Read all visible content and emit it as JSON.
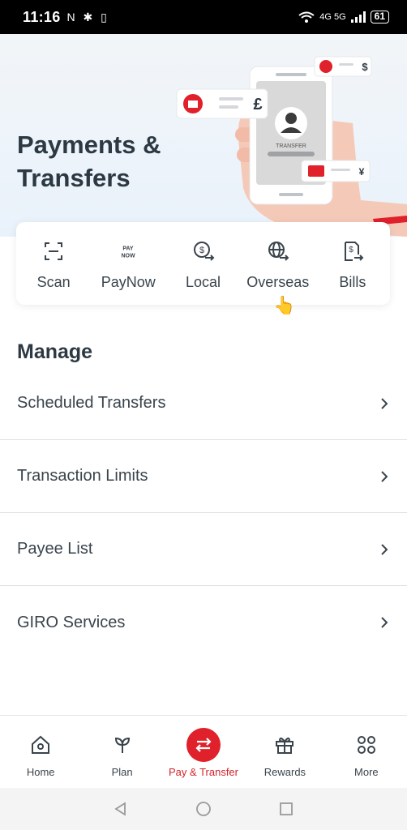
{
  "status_bar": {
    "time": "11:16",
    "left_icons": "N ✱ ▯",
    "battery": "61",
    "network": "4G 5G"
  },
  "hero": {
    "title": "Payments & Transfers",
    "phone_label": "TRANSFER",
    "currency_gbp": "£",
    "currency_usd": "$",
    "currency_jpy": "¥"
  },
  "quick_actions": [
    {
      "label": "Scan",
      "icon": "scan-icon"
    },
    {
      "label": "PayNow",
      "icon": "paynow-icon"
    },
    {
      "label": "Local",
      "icon": "local-transfer-icon"
    },
    {
      "label": "Overseas",
      "icon": "globe-transfer-icon"
    },
    {
      "label": "Bills",
      "icon": "bill-icon"
    }
  ],
  "manage": {
    "title": "Manage",
    "items": [
      {
        "label": "Scheduled Transfers"
      },
      {
        "label": "Transaction Limits"
      },
      {
        "label": "Payee List"
      },
      {
        "label": "GIRO Services"
      }
    ]
  },
  "bottom_nav": [
    {
      "label": "Home",
      "icon": "home-icon"
    },
    {
      "label": "Plan",
      "icon": "plant-icon"
    },
    {
      "label": "Pay & Transfer",
      "icon": "transfer-arrows-icon",
      "active": true
    },
    {
      "label": "Rewards",
      "icon": "gift-icon"
    },
    {
      "label": "More",
      "icon": "grid-icon"
    }
  ],
  "colors": {
    "accent": "#e0202a",
    "text": "#2c3942",
    "hero_bg": "#e9f2fb"
  }
}
